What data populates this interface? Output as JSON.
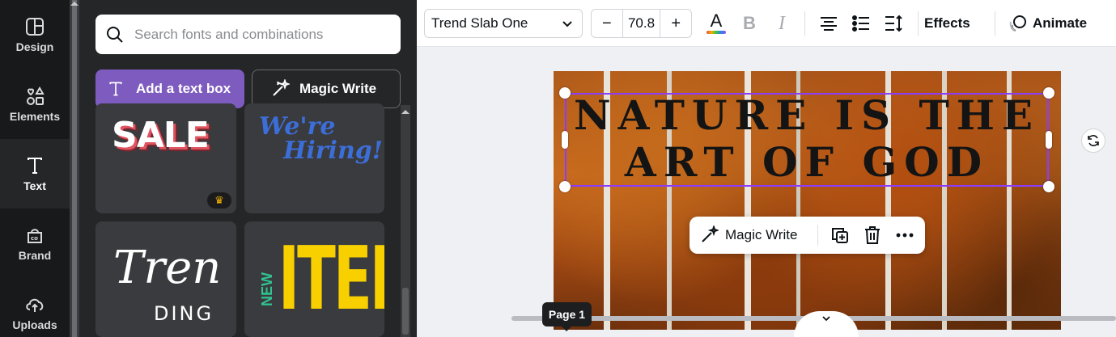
{
  "rail": {
    "items": [
      {
        "label": "Design",
        "icon": "design-icon",
        "active": false
      },
      {
        "label": "Elements",
        "icon": "elements-icon",
        "active": false
      },
      {
        "label": "Text",
        "icon": "text-icon",
        "active": true
      },
      {
        "label": "Brand",
        "icon": "brand-icon",
        "active": false
      },
      {
        "label": "Uploads",
        "icon": "uploads-icon",
        "active": false
      }
    ]
  },
  "panel": {
    "search_placeholder": "Search fonts and combinations",
    "add_text_box": "Add a text box",
    "magic_write": "Magic Write",
    "tiles": {
      "sale": "SALE",
      "hiring_line1": "We're",
      "hiring_line2": "Hiring!",
      "trending_top": "Tren",
      "trending_bottom": "DING",
      "new": "NEW",
      "item": "ITEM"
    }
  },
  "toolbar": {
    "font_name": "Trend Slab One",
    "font_size": "70.8",
    "minus": "−",
    "plus": "+",
    "font_color_glyph": "A",
    "bold_glyph": "B",
    "italic_glyph": "I",
    "effects": "Effects",
    "animate": "Animate"
  },
  "canvas": {
    "headline_line1": "NATURE IS THE",
    "headline_line2": "ART OF GOD",
    "context_magic_write": "Magic Write",
    "page_label": "Page 1"
  },
  "colors": {
    "accent_purple": "#7d5bbf",
    "selection": "#8b3dff",
    "rail_bg": "#18191b",
    "panel_bg": "#252627"
  }
}
